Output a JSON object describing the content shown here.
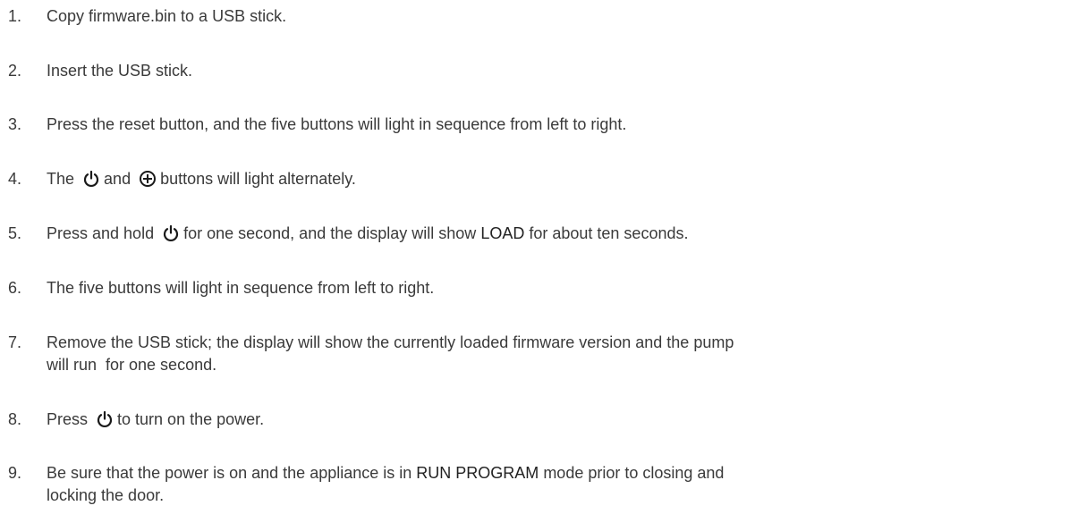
{
  "steps": [
    {
      "num": "1.",
      "text": "Copy firmware.bin to a USB stick."
    },
    {
      "num": "2.",
      "text": "Insert the USB stick."
    },
    {
      "num": "3.",
      "text": "Press the reset button, and the five buttons will light in sequence from left to right."
    },
    {
      "num": "4.",
      "pre": "The",
      "mid": "and",
      "post": "buttons will light alternately."
    },
    {
      "num": "5.",
      "pre": "Press and hold",
      "mid": "for one second, and the display will show",
      "kw": "LOAD",
      "post": "for about ten seconds."
    },
    {
      "num": "6.",
      "text": "The five buttons will light in sequence from left to right."
    },
    {
      "num": "7.",
      "line1": "Remove the USB stick; the display will show the currently loaded firmware version and the pump",
      "line2": "will run  for one second."
    },
    {
      "num": "8.",
      "pre": "Press",
      "post": "to turn on the power."
    },
    {
      "num": "9.",
      "pre": "Be sure that the power is on and the appliance is in",
      "kw": "RUN PROGRAM",
      "post": "mode prior to closing and",
      "line2": "locking the door."
    }
  ],
  "icons": {
    "power": "power-icon",
    "plus": "circled-plus-icon"
  }
}
